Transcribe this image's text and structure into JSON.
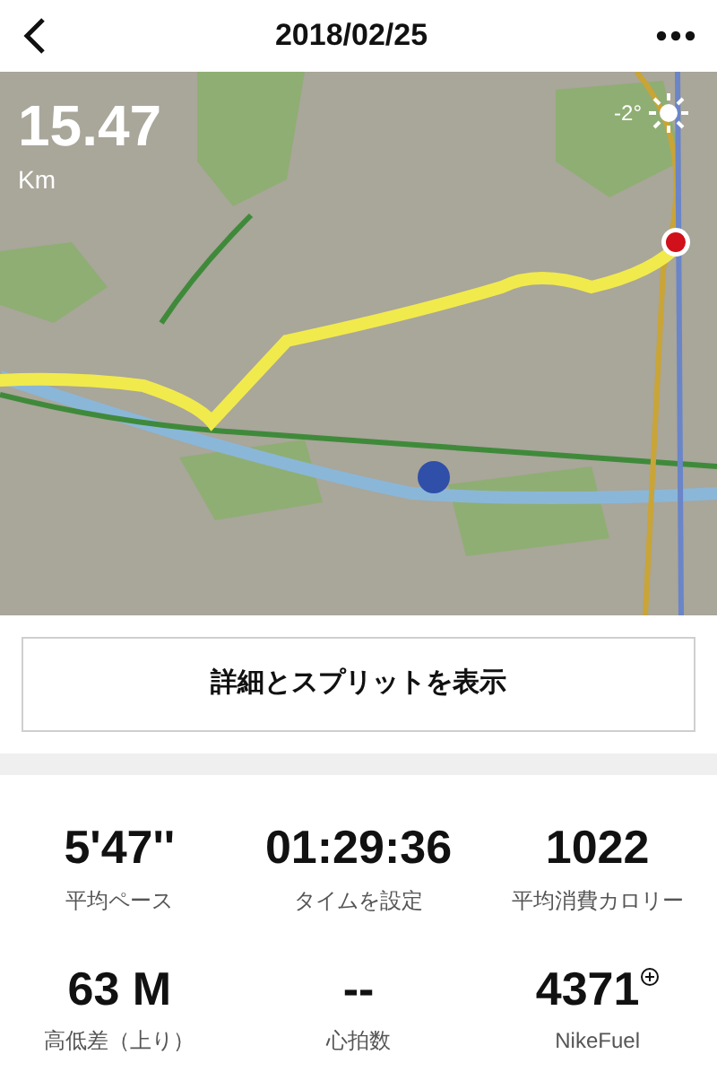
{
  "header": {
    "title": "2018/02/25"
  },
  "map": {
    "distance": "15.47",
    "unit": "Km",
    "temperature": "-2°"
  },
  "details_button": {
    "label": "詳細とスプリットを表示"
  },
  "stats": [
    {
      "value": "5'47''",
      "label": "平均ペース"
    },
    {
      "value": "01:29:36",
      "label": "タイムを設定"
    },
    {
      "value": "1022",
      "label": "平均消費カロリー"
    },
    {
      "value": "63 M",
      "label": "高低差（上り）"
    },
    {
      "value": "--",
      "label": "心拍数"
    },
    {
      "value": "4371",
      "label": "NikeFuel",
      "kind": "fuel"
    }
  ]
}
